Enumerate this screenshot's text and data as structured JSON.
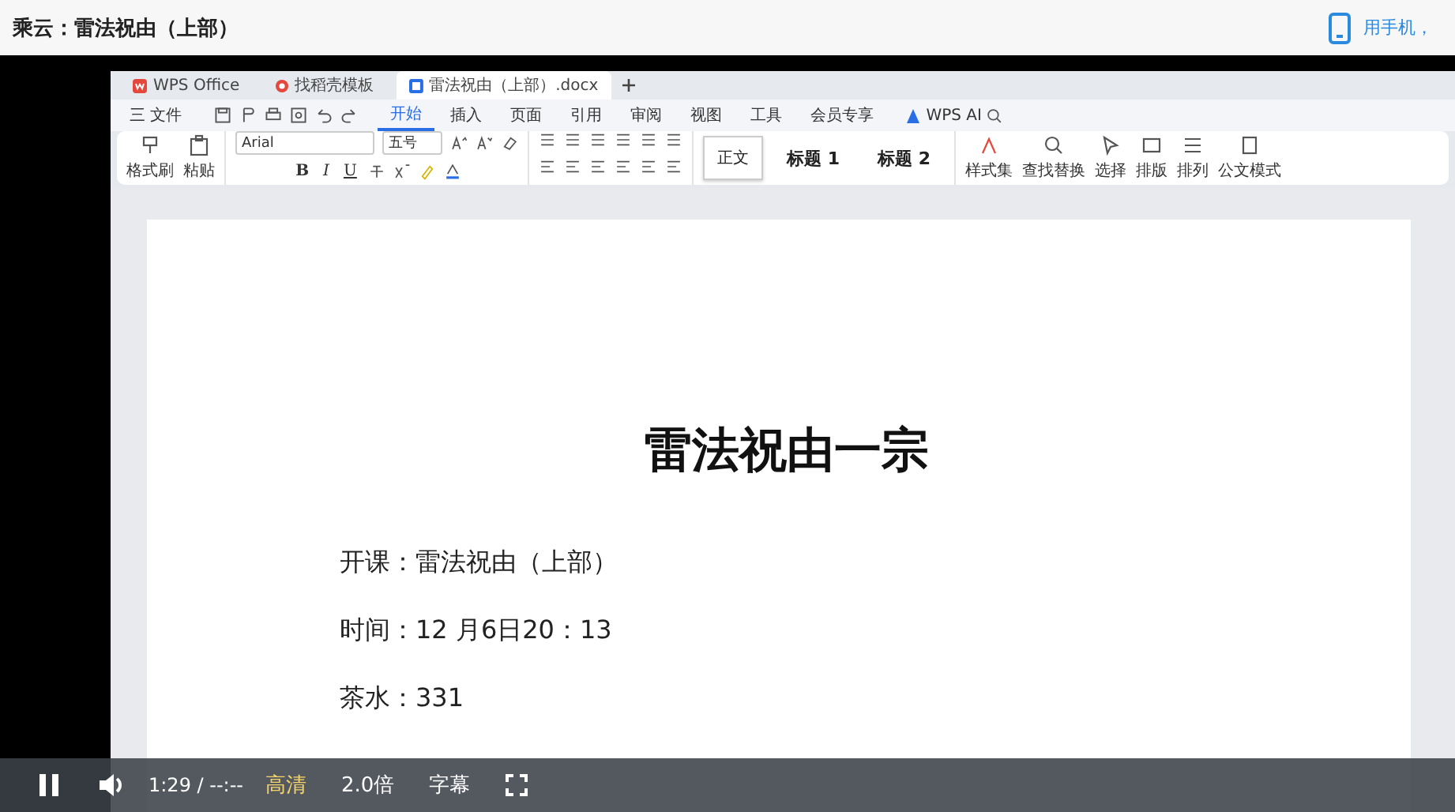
{
  "header": {
    "title": "乘云：雷法祝由（上部）",
    "phone_link": "用手机，"
  },
  "wps": {
    "tabs": [
      {
        "label": "WPS Office",
        "kind": "home",
        "selected": false
      },
      {
        "label": "找稻壳模板",
        "kind": "template",
        "selected": false
      },
      {
        "label": "雷法祝由（上部）.docx",
        "kind": "doc",
        "selected": true
      }
    ],
    "menu": [
      {
        "label": "三 文件",
        "selected": false
      },
      {
        "label": "开始",
        "selected": true
      },
      {
        "label": "插入",
        "selected": false
      },
      {
        "label": "页面",
        "selected": false
      },
      {
        "label": "引用",
        "selected": false
      },
      {
        "label": "审阅",
        "selected": false
      },
      {
        "label": "视图",
        "selected": false
      },
      {
        "label": "工具",
        "selected": false
      },
      {
        "label": "会员专享",
        "selected": false
      }
    ],
    "ai_label": "WPS AI",
    "ribbon": {
      "clipboard": [
        "格式刷",
        "粘贴"
      ],
      "font": "Arial",
      "size": "五号",
      "format": [
        "B",
        "I",
        "U"
      ],
      "styles": [
        {
          "label": "正文",
          "selected": true
        },
        {
          "label": "标题 1",
          "selected": false
        },
        {
          "label": "标题 2",
          "selected": false
        }
      ],
      "tools": [
        "样式集",
        "查找替换",
        "选择",
        "排版",
        "排列",
        "公文模式"
      ]
    }
  },
  "document": {
    "title": "雷法祝由一宗",
    "lines": [
      "开课：雷法祝由（上部）",
      "时间：12 月6日20：13",
      "茶水：331"
    ]
  },
  "controls": {
    "playing": true,
    "time": "1:29 / --:--",
    "quality": "高清",
    "speed": "2.0倍",
    "subtitles": "字幕"
  }
}
